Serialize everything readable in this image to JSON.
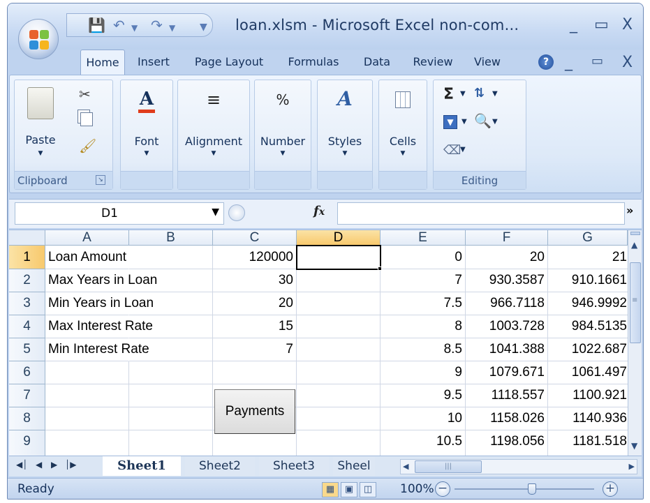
{
  "window": {
    "title": "loan.xlsm - Microsoft Excel non-com...",
    "controls": [
      "_",
      "▭",
      "X"
    ]
  },
  "ribbon": {
    "tabs": [
      "Home",
      "Insert",
      "Page Layout",
      "Formulas",
      "Data",
      "Review",
      "View"
    ],
    "active_tab": "Home",
    "workbook_controls": [
      "_",
      "▭",
      "X"
    ],
    "groups": {
      "clipboard": {
        "label": "Clipboard",
        "paste": "Paste"
      },
      "font": {
        "name": "Font"
      },
      "alignment": {
        "name": "Alignment"
      },
      "number": {
        "name": "Number"
      },
      "styles": {
        "name": "Styles"
      },
      "cells": {
        "name": "Cells"
      },
      "editing": {
        "label": "Editing"
      }
    }
  },
  "formula_bar": {
    "name_box": "D1",
    "fx": "fx",
    "formula": ""
  },
  "sheet": {
    "columns": [
      "A",
      "B",
      "C",
      "D",
      "E",
      "F",
      "G"
    ],
    "selected_column": "D",
    "rows": [
      "1",
      "2",
      "3",
      "4",
      "5",
      "6",
      "7",
      "8",
      "9"
    ],
    "selected_row": "1",
    "labels": [
      "Loan Amount",
      "Max Years in Loan",
      "Min Years in Loan",
      "Max Interest Rate",
      "Min Interest Rate"
    ],
    "c_values": [
      "120000",
      "30",
      "20",
      "15",
      "7"
    ],
    "e_values": [
      "0",
      "7",
      "7.5",
      "8",
      "8.5",
      "9",
      "9.5",
      "10",
      "10.5"
    ],
    "f_values": [
      "20",
      "930.3587",
      "966.7118",
      "1003.728",
      "1041.388",
      "1079.671",
      "1118.557",
      "1158.026",
      "1198.056"
    ],
    "g_values": [
      "21",
      "910.1661",
      "946.9992",
      "984.5135",
      "1022.687",
      "1061.497",
      "1100.921",
      "1140.936",
      "1181.518"
    ],
    "button_label": "Payments"
  },
  "sheet_tabs": [
    "Sheet1",
    "Sheet2",
    "Sheet3",
    "Sheel"
  ],
  "active_sheet": "Sheet1",
  "status": {
    "text": "Ready",
    "zoom": "100%",
    "zoom_level": 100
  },
  "colors": {
    "selected_header": "#f8c96d",
    "ribbon_bg": "#dde9f8",
    "frame": "#bfd3ef"
  }
}
